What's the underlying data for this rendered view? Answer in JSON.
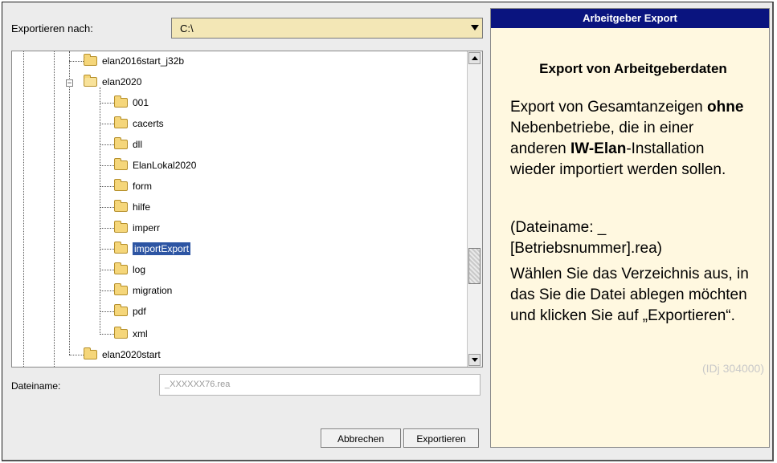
{
  "export_label": "Exportieren nach:",
  "path_value": "C:\\",
  "tree": {
    "items": [
      {
        "label": "elan2016start_j32b"
      },
      {
        "label": "elan2020"
      },
      {
        "label": "001"
      },
      {
        "label": "cacerts"
      },
      {
        "label": "dll"
      },
      {
        "label": "ElanLokal2020"
      },
      {
        "label": "form"
      },
      {
        "label": "hilfe"
      },
      {
        "label": "imperr"
      },
      {
        "label": "importExport"
      },
      {
        "label": "log"
      },
      {
        "label": "migration"
      },
      {
        "label": "pdf"
      },
      {
        "label": "xml"
      },
      {
        "label": "elan2020start"
      }
    ]
  },
  "filename": {
    "label": "Dateiname:",
    "value": "_XXXXXX76.rea"
  },
  "buttons": {
    "cancel": "Abbrechen",
    "export": "Exportieren"
  },
  "info": {
    "header": "Arbeitgeber Export",
    "title": "Export von Arbeitgeberdaten",
    "p1_a": "Export von Gesamtanzeigen ",
    "p1_b": "ohne",
    "p1_c": " Nebenbetriebe, die in einer anderen ",
    "p1_d": "IW-Elan",
    "p1_e": "-Installation wieder importiert werden sollen.",
    "p2": "(Dateiname: _ [Betriebsnummer].rea)",
    "p3": "Wählen Sie das Verzeichnis aus, in das Sie die Datei ablegen möchten und klicken Sie auf „Exportieren“.",
    "id": "(IDj 304000)"
  },
  "colors": {
    "header_bg": "#0a147f",
    "info_bg": "#fff8e0",
    "selection": "#2d55a3",
    "combo_bg": "#f3e7b6"
  }
}
